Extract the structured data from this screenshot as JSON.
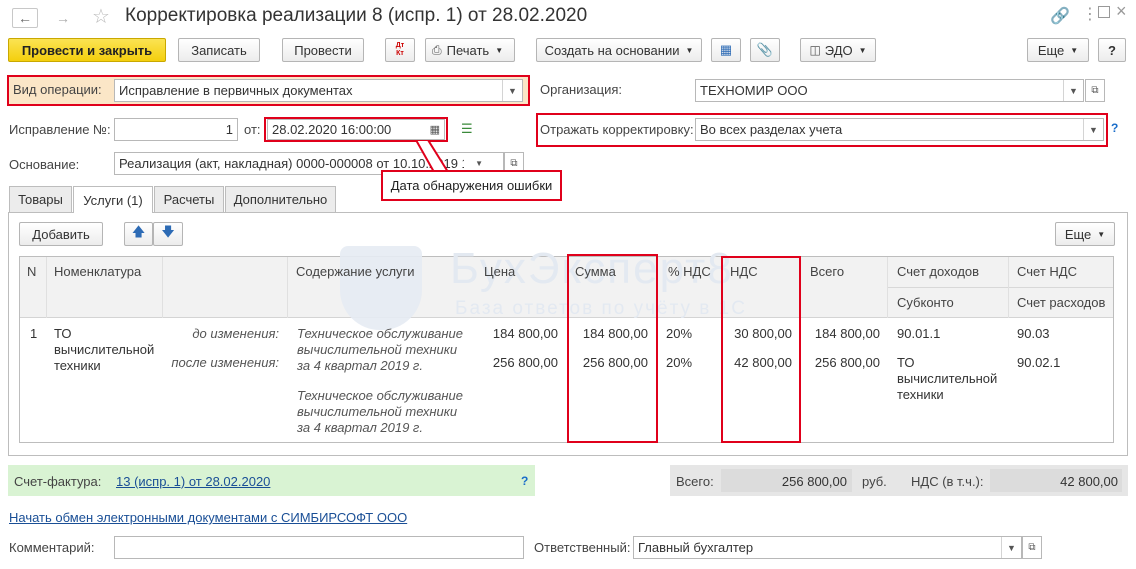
{
  "window": {
    "title": "Корректировка реализации 8 (испр. 1) от 28.02.2020"
  },
  "toolbar": {
    "post_close": "Провести и закрыть",
    "save": "Записать",
    "post": "Провести",
    "dt_kt": "Дт Кт",
    "print": "Печать",
    "create_based": "Создать на основании",
    "edo": "ЭДО",
    "more": "Еще",
    "help": "?"
  },
  "form": {
    "operation_label": "Вид операции:",
    "operation_value": "Исправление в первичных документах",
    "org_label": "Организация:",
    "org_value": "ТЕХНОМИР ООО",
    "correction_label": "Исправление №:",
    "correction_value": "1",
    "from_label": "от:",
    "date_value": "28.02.2020 16:00:00",
    "reflect_label": "Отражать корректировку:",
    "reflect_value": "Во всех разделах учета",
    "reflect_help": "?",
    "basis_label": "Основание:",
    "basis_value": "Реализация (акт, накладная) 0000-000008 от 10.10.2019 1"
  },
  "callout": {
    "text": "Дата обнаружения ошибки"
  },
  "tabs": [
    "Товары",
    "Услуги (1)",
    "Расчеты",
    "Дополнительно"
  ],
  "table_toolbar": {
    "add": "Добавить",
    "more": "Еще"
  },
  "watermark": {
    "title": "БухЭксперт8",
    "subtitle": "База ответов по учёту в 1С"
  },
  "table": {
    "headers": {
      "n": "N",
      "nomenclature": "Номенклатура",
      "content": "Содержание услуги",
      "price": "Цена",
      "sum": "Сумма",
      "vat_rate": "% НДС",
      "vat": "НДС",
      "total": "Всего",
      "income_account": "Счет доходов",
      "subconto": "Субконто",
      "vat_account": "Счет НДС",
      "expense_account": "Счет расходов"
    },
    "row": {
      "n": "1",
      "nomenclature": "ТО вычислительной техники",
      "before_label": "до изменения:",
      "after_label": "после изменения:",
      "content_before": "Техническое обслуживание вычислительной техники за 4 квартал 2019 г.",
      "content_after": "Техническое обслуживание вычислительной техники за 4 квартал 2019 г.",
      "price_before": "184 800,00",
      "price_after": "256 800,00",
      "sum_before": "184 800,00",
      "sum_after": "256 800,00",
      "vat_rate_before": "20%",
      "vat_rate_after": "20%",
      "vat_before": "30 800,00",
      "vat_after": "42 800,00",
      "total_before": "184 800,00",
      "total_after": "256 800,00",
      "income_account": "90.01.1",
      "subconto": "ТО вычислительной техники",
      "vat_account": "90.03",
      "expense_account": "90.02.1"
    }
  },
  "footer": {
    "invoice_label": "Счет-фактура:",
    "invoice_link": "13 (испр. 1) от 28.02.2020",
    "invoice_help": "?",
    "total_label": "Всего:",
    "total_value": "256 800,00",
    "currency": "руб.",
    "vat_label": "НДС (в т.ч.):",
    "vat_value": "42 800,00",
    "edo_link": "Начать обмен электронными документами с СИМБИРСОФТ ООО",
    "comment_label": "Комментарий:",
    "comment_value": "",
    "responsible_label": "Ответственный:",
    "responsible_value": "Главный бухгалтер"
  }
}
